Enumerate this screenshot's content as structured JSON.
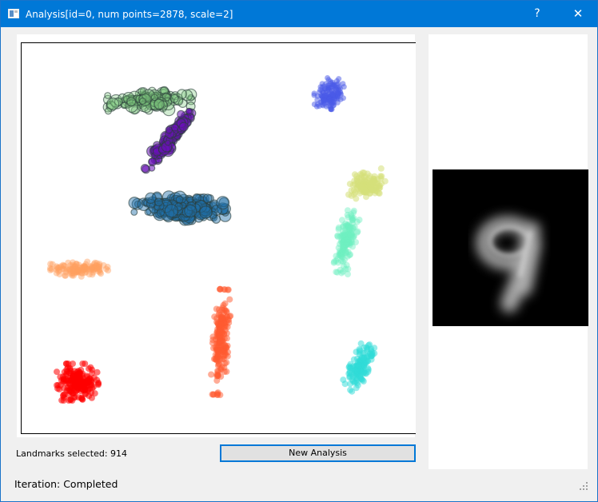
{
  "window": {
    "title": "Analysis[id=0, num points=2878, scale=2]",
    "help_label": "?",
    "close_label": "✕",
    "icon": "app-window-icon"
  },
  "status": {
    "landmarks_text": "Landmarks selected: 914",
    "iteration_text": "Iteration: Completed"
  },
  "actions": {
    "new_analysis_label": "New Analysis"
  },
  "embedding": {
    "clusters": [
      {
        "color": "#4a5ae8",
        "kind": "cloud",
        "shape": "blob"
      },
      {
        "color": "#7fc87f",
        "kind": "landmarks",
        "shape": "streak"
      },
      {
        "color": "#6a10b8",
        "kind": "landmarks",
        "shape": "streak"
      },
      {
        "color": "#1f6fa8",
        "kind": "landmarks",
        "shape": "streak"
      },
      {
        "color": "#d6e07a",
        "kind": "cloud",
        "shape": "blob"
      },
      {
        "color": "#6ef0c0",
        "kind": "cloud",
        "shape": "streak"
      },
      {
        "color": "#ffa060",
        "kind": "cloud",
        "shape": "streak"
      },
      {
        "color": "#ff5a30",
        "kind": "cloud",
        "shape": "streak"
      },
      {
        "color": "#ff0000",
        "kind": "cloud",
        "shape": "blob"
      },
      {
        "color": "#30dcd8",
        "kind": "cloud",
        "shape": "streak"
      }
    ]
  },
  "colors": {
    "titlebar": "#0078d7",
    "focus_border": "#0078d7"
  }
}
